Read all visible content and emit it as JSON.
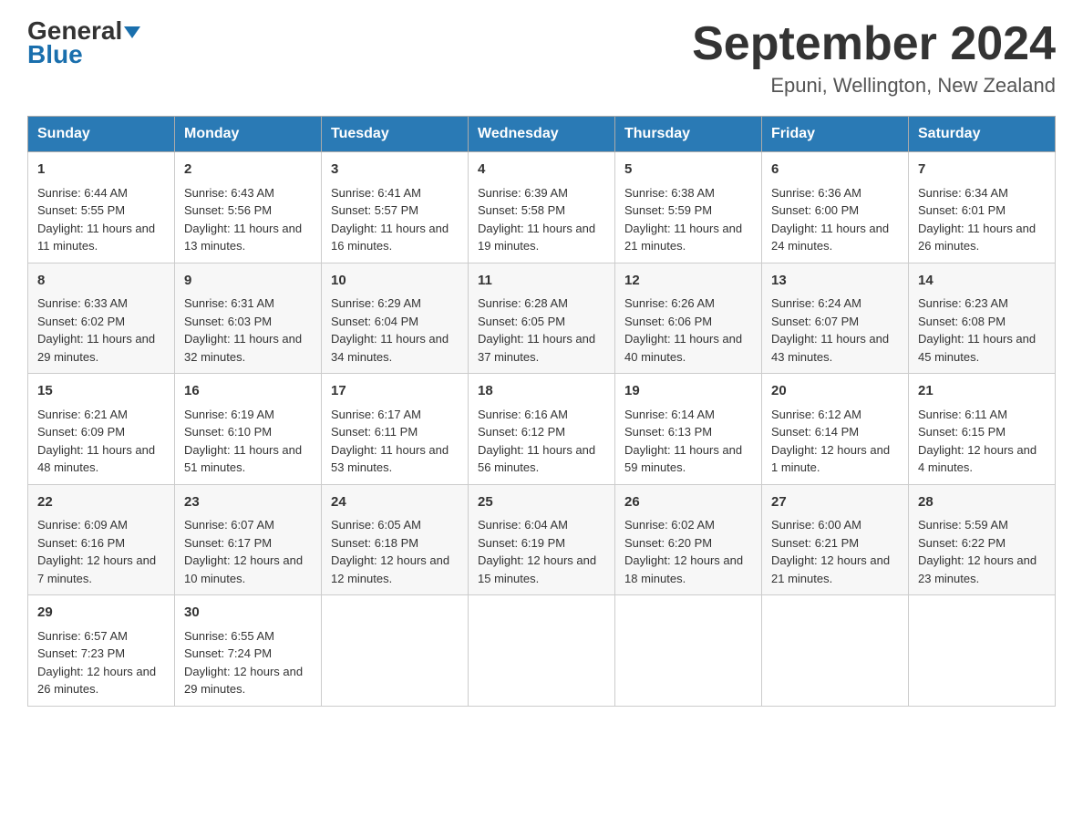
{
  "header": {
    "logo_main": "General",
    "logo_sub": "Blue",
    "title": "September 2024",
    "location": "Epuni, Wellington, New Zealand"
  },
  "weekdays": [
    "Sunday",
    "Monday",
    "Tuesday",
    "Wednesday",
    "Thursday",
    "Friday",
    "Saturday"
  ],
  "weeks": [
    [
      {
        "day": "1",
        "sunrise": "6:44 AM",
        "sunset": "5:55 PM",
        "daylight": "11 hours and 11 minutes."
      },
      {
        "day": "2",
        "sunrise": "6:43 AM",
        "sunset": "5:56 PM",
        "daylight": "11 hours and 13 minutes."
      },
      {
        "day": "3",
        "sunrise": "6:41 AM",
        "sunset": "5:57 PM",
        "daylight": "11 hours and 16 minutes."
      },
      {
        "day": "4",
        "sunrise": "6:39 AM",
        "sunset": "5:58 PM",
        "daylight": "11 hours and 19 minutes."
      },
      {
        "day": "5",
        "sunrise": "6:38 AM",
        "sunset": "5:59 PM",
        "daylight": "11 hours and 21 minutes."
      },
      {
        "day": "6",
        "sunrise": "6:36 AM",
        "sunset": "6:00 PM",
        "daylight": "11 hours and 24 minutes."
      },
      {
        "day": "7",
        "sunrise": "6:34 AM",
        "sunset": "6:01 PM",
        "daylight": "11 hours and 26 minutes."
      }
    ],
    [
      {
        "day": "8",
        "sunrise": "6:33 AM",
        "sunset": "6:02 PM",
        "daylight": "11 hours and 29 minutes."
      },
      {
        "day": "9",
        "sunrise": "6:31 AM",
        "sunset": "6:03 PM",
        "daylight": "11 hours and 32 minutes."
      },
      {
        "day": "10",
        "sunrise": "6:29 AM",
        "sunset": "6:04 PM",
        "daylight": "11 hours and 34 minutes."
      },
      {
        "day": "11",
        "sunrise": "6:28 AM",
        "sunset": "6:05 PM",
        "daylight": "11 hours and 37 minutes."
      },
      {
        "day": "12",
        "sunrise": "6:26 AM",
        "sunset": "6:06 PM",
        "daylight": "11 hours and 40 minutes."
      },
      {
        "day": "13",
        "sunrise": "6:24 AM",
        "sunset": "6:07 PM",
        "daylight": "11 hours and 43 minutes."
      },
      {
        "day": "14",
        "sunrise": "6:23 AM",
        "sunset": "6:08 PM",
        "daylight": "11 hours and 45 minutes."
      }
    ],
    [
      {
        "day": "15",
        "sunrise": "6:21 AM",
        "sunset": "6:09 PM",
        "daylight": "11 hours and 48 minutes."
      },
      {
        "day": "16",
        "sunrise": "6:19 AM",
        "sunset": "6:10 PM",
        "daylight": "11 hours and 51 minutes."
      },
      {
        "day": "17",
        "sunrise": "6:17 AM",
        "sunset": "6:11 PM",
        "daylight": "11 hours and 53 minutes."
      },
      {
        "day": "18",
        "sunrise": "6:16 AM",
        "sunset": "6:12 PM",
        "daylight": "11 hours and 56 minutes."
      },
      {
        "day": "19",
        "sunrise": "6:14 AM",
        "sunset": "6:13 PM",
        "daylight": "11 hours and 59 minutes."
      },
      {
        "day": "20",
        "sunrise": "6:12 AM",
        "sunset": "6:14 PM",
        "daylight": "12 hours and 1 minute."
      },
      {
        "day": "21",
        "sunrise": "6:11 AM",
        "sunset": "6:15 PM",
        "daylight": "12 hours and 4 minutes."
      }
    ],
    [
      {
        "day": "22",
        "sunrise": "6:09 AM",
        "sunset": "6:16 PM",
        "daylight": "12 hours and 7 minutes."
      },
      {
        "day": "23",
        "sunrise": "6:07 AM",
        "sunset": "6:17 PM",
        "daylight": "12 hours and 10 minutes."
      },
      {
        "day": "24",
        "sunrise": "6:05 AM",
        "sunset": "6:18 PM",
        "daylight": "12 hours and 12 minutes."
      },
      {
        "day": "25",
        "sunrise": "6:04 AM",
        "sunset": "6:19 PM",
        "daylight": "12 hours and 15 minutes."
      },
      {
        "day": "26",
        "sunrise": "6:02 AM",
        "sunset": "6:20 PM",
        "daylight": "12 hours and 18 minutes."
      },
      {
        "day": "27",
        "sunrise": "6:00 AM",
        "sunset": "6:21 PM",
        "daylight": "12 hours and 21 minutes."
      },
      {
        "day": "28",
        "sunrise": "5:59 AM",
        "sunset": "6:22 PM",
        "daylight": "12 hours and 23 minutes."
      }
    ],
    [
      {
        "day": "29",
        "sunrise": "6:57 AM",
        "sunset": "7:23 PM",
        "daylight": "12 hours and 26 minutes."
      },
      {
        "day": "30",
        "sunrise": "6:55 AM",
        "sunset": "7:24 PM",
        "daylight": "12 hours and 29 minutes."
      },
      null,
      null,
      null,
      null,
      null
    ]
  ],
  "labels": {
    "sunrise": "Sunrise:",
    "sunset": "Sunset:",
    "daylight": "Daylight:"
  }
}
